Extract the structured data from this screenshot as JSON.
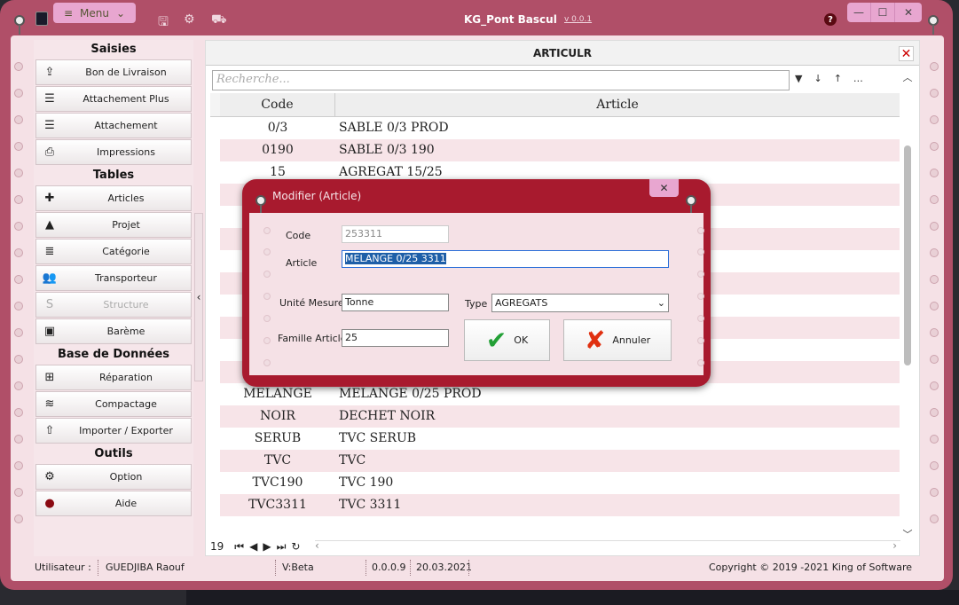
{
  "app": {
    "title": "KG_Pont Bascul",
    "version": "v 0.0.1",
    "menu_label": "Menu"
  },
  "window_controls": {
    "minimize": "—",
    "maximize": "☐",
    "close": "✕"
  },
  "sidebar": {
    "sections": [
      {
        "title": "Saisies",
        "items": [
          {
            "label": "Bon de Livraison",
            "icon": "delivery-icon"
          },
          {
            "label": "Attachement Plus",
            "icon": "list-icon"
          },
          {
            "label": "Attachement",
            "icon": "list-icon"
          },
          {
            "label": "Impressions",
            "icon": "printer-icon"
          }
        ]
      },
      {
        "title": "Tables",
        "items": [
          {
            "label": "Articles",
            "icon": "puzzle-icon"
          },
          {
            "label": "Projet",
            "icon": "road-icon"
          },
          {
            "label": "Catégorie",
            "icon": "numbered-list-icon"
          },
          {
            "label": "Transporteur",
            "icon": "users-icon"
          },
          {
            "label": "Structure",
            "icon": "structure-icon",
            "disabled": true
          },
          {
            "label": "Barème",
            "icon": "money-icon"
          }
        ]
      },
      {
        "title": "Base de Données",
        "items": [
          {
            "label": "Réparation",
            "icon": "medkit-icon"
          },
          {
            "label": "Compactage",
            "icon": "compress-icon"
          },
          {
            "label": "Importer  / Exporter",
            "icon": "upload-icon"
          }
        ]
      },
      {
        "title": "Outils",
        "items": [
          {
            "label": "Option",
            "icon": "gears-icon"
          },
          {
            "label": "Aide",
            "icon": "help-icon"
          }
        ]
      }
    ]
  },
  "main": {
    "title": "ARTICULR",
    "search_placeholder": "Recherche...",
    "columns": {
      "code": "Code",
      "article": "Article"
    },
    "rows": [
      {
        "code": "0/3",
        "article": "SABLE 0/3 PROD"
      },
      {
        "code": "0190",
        "article": "SABLE 0/3 190"
      },
      {
        "code": "15",
        "article": "AGREGAT 15/25"
      },
      {
        "code": "",
        "article": ""
      },
      {
        "code": "",
        "article": ""
      },
      {
        "code": "",
        "article": ""
      },
      {
        "code": "",
        "article": ""
      },
      {
        "code": "",
        "article": ""
      },
      {
        "code": "",
        "article": ""
      },
      {
        "code": "",
        "article": ""
      },
      {
        "code": "",
        "article": ""
      },
      {
        "code": "",
        "article": ""
      },
      {
        "code": "MELANGE",
        "article": "MELANGE 0/25 PROD"
      },
      {
        "code": "NOIR",
        "article": "DECHET NOIR"
      },
      {
        "code": "SERUB",
        "article": "TVC SERUB"
      },
      {
        "code": "TVC",
        "article": "TVC"
      },
      {
        "code": "TVC190",
        "article": "TVC 190"
      },
      {
        "code": "TVC3311",
        "article": "TVC  3311"
      }
    ],
    "record_count": "19"
  },
  "dialog": {
    "title": "Modifier (Article)",
    "code_label": "Code",
    "code_value": "253311",
    "article_label": "Article",
    "article_value": "MELANGE 0/25 3311",
    "unite_label": "Unité Mesure",
    "unite_value": "Tonne",
    "type_label": "Type",
    "type_value": "AGREGATS",
    "famille_label": "Famille Article",
    "famille_value": "25",
    "ok_label": "OK",
    "cancel_label": "Annuler"
  },
  "status": {
    "user_label": "Utilisateur :",
    "user_name": "GUEDJIBA Raouf",
    "version": "V:Beta",
    "build": "0.0.0.9",
    "date": "20.03.2021",
    "copyright": "Copyright © 2019 -2021 King of Software"
  },
  "colors": {
    "frame": "#b04f68",
    "page": "#f5e1e6",
    "dialog": "#a81a2e",
    "accent": "#e8a6d0"
  }
}
